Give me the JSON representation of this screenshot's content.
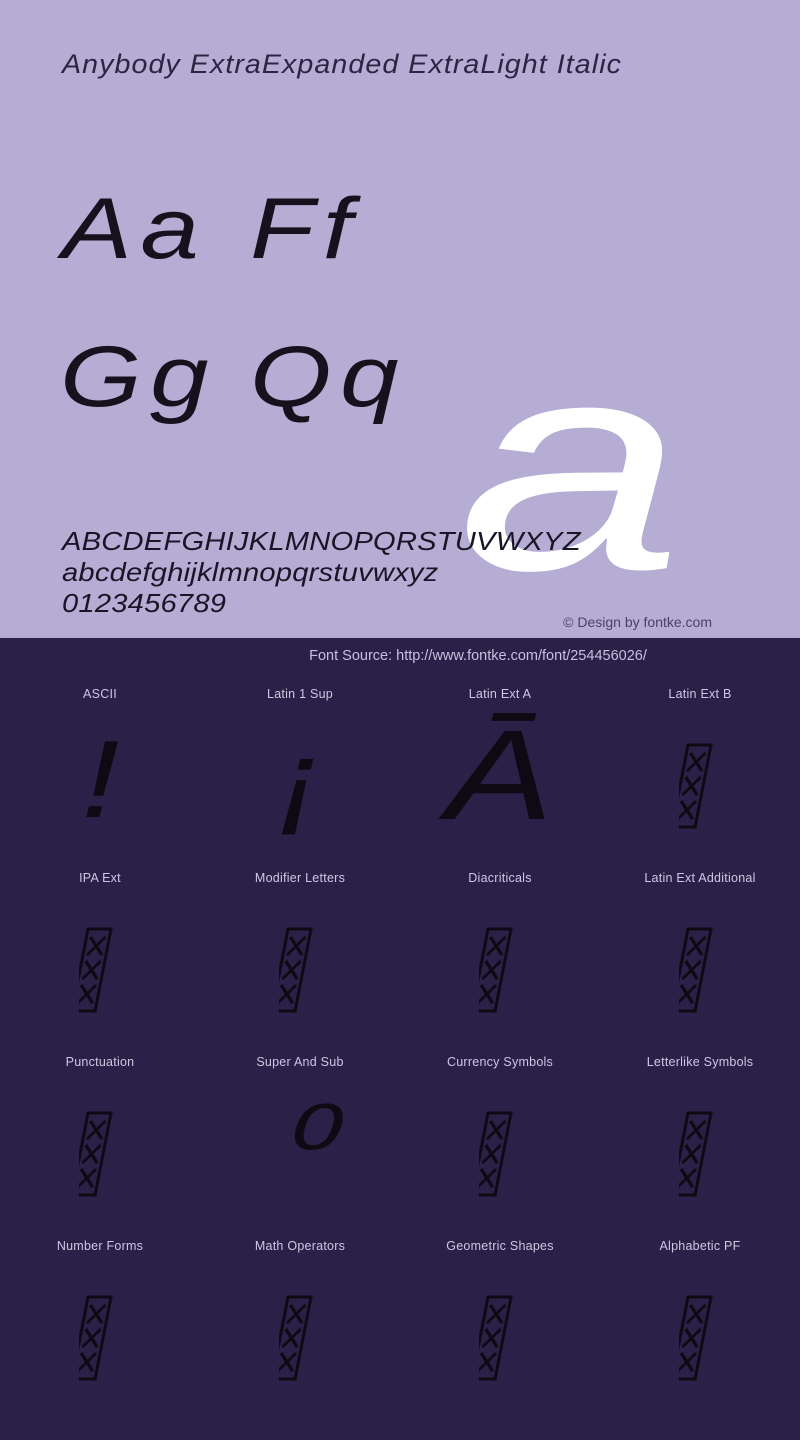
{
  "specimen": {
    "title": "Anybody ExtraExpanded ExtraLight Italic",
    "background_color": "#b6add5",
    "glyph_pairs": [
      "Aa",
      "Ff",
      "Gg",
      "Qq"
    ],
    "hero_glyph": "a",
    "hero_glyph_color": "#ffffff",
    "alphabet_lines": [
      "ABCDEFGHIJKLMNOPQRSTUVWXYZ",
      "abcdefghijklmnopqrstuvwxyz",
      "0123456789"
    ],
    "copyright": "© Design by fontke.com"
  },
  "coverage": {
    "background_color": "#2b2148",
    "font_source": "Font Source: http://www.fontke.com/font/254456026/",
    "rows": [
      [
        {
          "label": "ASCII",
          "sample": "!",
          "sample_kind": "char"
        },
        {
          "label": "Latin 1 Sup",
          "sample": "¡",
          "sample_kind": "char"
        },
        {
          "label": "Latin Ext A",
          "sample": "Ā",
          "sample_kind": "char-big"
        },
        {
          "label": "Latin Ext B",
          "sample": "",
          "sample_kind": "notdef"
        }
      ],
      [
        {
          "label": "IPA Ext",
          "sample": "",
          "sample_kind": "notdef"
        },
        {
          "label": "Modifier Letters",
          "sample": "",
          "sample_kind": "notdef"
        },
        {
          "label": "Diacriticals",
          "sample": "",
          "sample_kind": "notdef"
        },
        {
          "label": "Latin Ext Additional",
          "sample": "",
          "sample_kind": "notdef"
        }
      ],
      [
        {
          "label": "Punctuation",
          "sample": "",
          "sample_kind": "notdef"
        },
        {
          "label": "Super And Sub",
          "sample": "⁰",
          "sample_kind": "char"
        },
        {
          "label": "Currency Symbols",
          "sample": "",
          "sample_kind": "notdef"
        },
        {
          "label": "Letterlike Symbols",
          "sample": "",
          "sample_kind": "notdef"
        }
      ],
      [
        {
          "label": "Number Forms",
          "sample": "",
          "sample_kind": "notdef"
        },
        {
          "label": "Math Operators",
          "sample": "",
          "sample_kind": "notdef"
        },
        {
          "label": "Geometric Shapes",
          "sample": "",
          "sample_kind": "notdef"
        },
        {
          "label": "Alphabetic PF",
          "sample": "",
          "sample_kind": "notdef"
        }
      ]
    ]
  }
}
